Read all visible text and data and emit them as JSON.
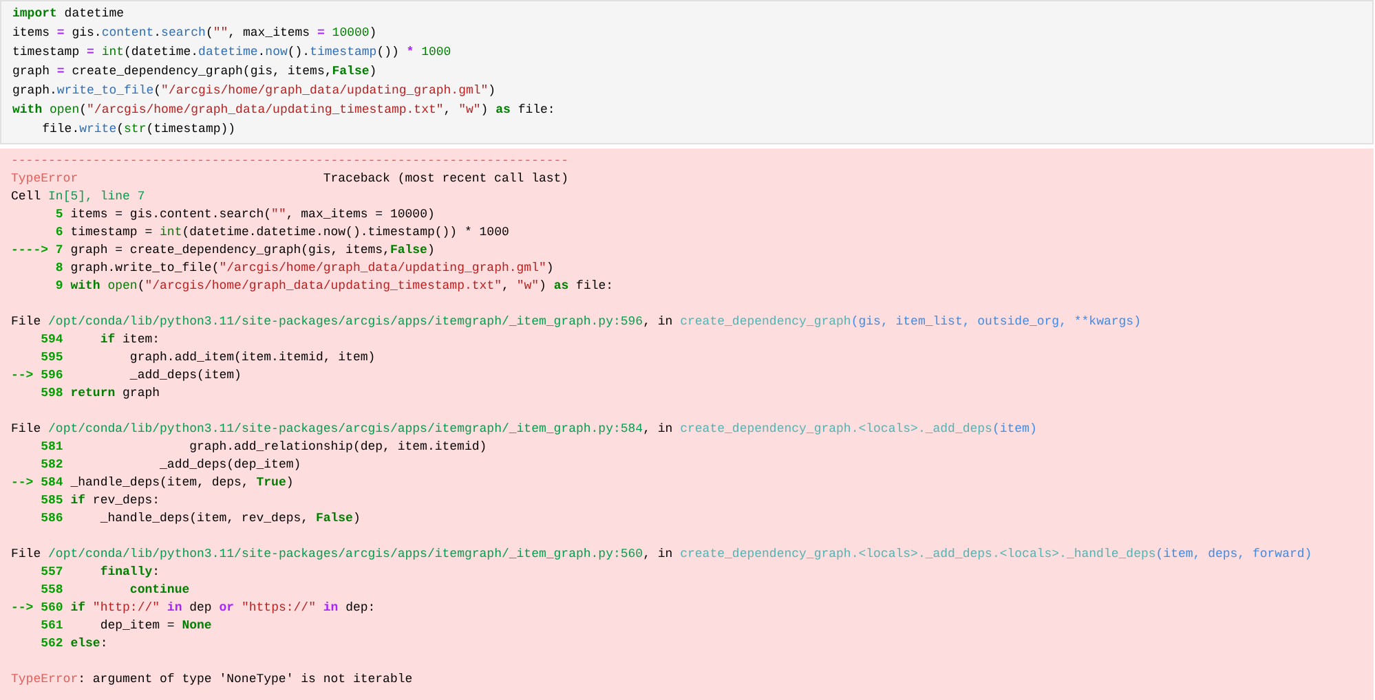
{
  "input_cell": {
    "lines": [
      {
        "kind": "code",
        "tokens": [
          {
            "text": "import",
            "kind": "kw"
          },
          {
            "text": " datetime",
            "kind": "plain"
          }
        ]
      },
      {
        "kind": "code",
        "tokens": [
          {
            "text": "items ",
            "kind": "plain"
          },
          {
            "text": "=",
            "kind": "op"
          },
          {
            "text": " gis.",
            "kind": "plain"
          },
          {
            "text": "content",
            "kind": "attr"
          },
          {
            "text": ".",
            "kind": "plain"
          },
          {
            "text": "search",
            "kind": "attr"
          },
          {
            "text": "(",
            "kind": "plain"
          },
          {
            "text": "\"\"",
            "kind": "str"
          },
          {
            "text": ", max_items ",
            "kind": "plain"
          },
          {
            "text": "=",
            "kind": "op"
          },
          {
            "text": " 10000",
            "kind": "num"
          },
          {
            "text": ")",
            "kind": "plain"
          }
        ]
      },
      {
        "kind": "code",
        "tokens": [
          {
            "text": "timestamp ",
            "kind": "plain"
          },
          {
            "text": "=",
            "kind": "op"
          },
          {
            "text": " int",
            "kind": "bi"
          },
          {
            "text": "(datetime.",
            "kind": "plain"
          },
          {
            "text": "datetime",
            "kind": "attr"
          },
          {
            "text": ".",
            "kind": "plain"
          },
          {
            "text": "now",
            "kind": "attr"
          },
          {
            "text": "().",
            "kind": "plain"
          },
          {
            "text": "timestamp",
            "kind": "attr"
          },
          {
            "text": "()) ",
            "kind": "plain"
          },
          {
            "text": "*",
            "kind": "op"
          },
          {
            "text": " 1000",
            "kind": "num"
          }
        ]
      },
      {
        "kind": "code",
        "tokens": [
          {
            "text": "graph ",
            "kind": "plain"
          },
          {
            "text": "=",
            "kind": "op"
          },
          {
            "text": " create_dependency_graph(gis, items,",
            "kind": "plain"
          },
          {
            "text": "False",
            "kind": "kw"
          },
          {
            "text": ")",
            "kind": "plain"
          }
        ]
      },
      {
        "kind": "code",
        "tokens": [
          {
            "text": "graph.",
            "kind": "plain"
          },
          {
            "text": "write_to_file",
            "kind": "attr"
          },
          {
            "text": "(",
            "kind": "plain"
          },
          {
            "text": "\"/arcgis/home/graph_data/updating_graph.gml\"",
            "kind": "str"
          },
          {
            "text": ")",
            "kind": "plain"
          }
        ]
      },
      {
        "kind": "code",
        "tokens": [
          {
            "text": "with",
            "kind": "kw"
          },
          {
            "text": " open",
            "kind": "bi"
          },
          {
            "text": "(",
            "kind": "plain"
          },
          {
            "text": "\"/arcgis/home/graph_data/updating_timestamp.txt\"",
            "kind": "str"
          },
          {
            "text": ", ",
            "kind": "plain"
          },
          {
            "text": "\"w\"",
            "kind": "str"
          },
          {
            "text": ") ",
            "kind": "plain"
          },
          {
            "text": "as",
            "kind": "kw"
          },
          {
            "text": " file:",
            "kind": "plain"
          }
        ]
      },
      {
        "kind": "code",
        "tokens": [
          {
            "text": "    file.",
            "kind": "plain"
          },
          {
            "text": "write",
            "kind": "attr"
          },
          {
            "text": "(",
            "kind": "plain"
          },
          {
            "text": "str",
            "kind": "bi"
          },
          {
            "text": "(timestamp))",
            "kind": "plain"
          }
        ]
      }
    ]
  },
  "error_output": {
    "lines": [
      {
        "kind": "code",
        "tokens": [
          {
            "text": "---------------------------------------------------------------------------",
            "kind": "err"
          }
        ]
      },
      {
        "kind": "code",
        "tokens": [
          {
            "text": "TypeError",
            "kind": "err"
          },
          {
            "text": "                                 Traceback (most recent call last)",
            "kind": "plain"
          }
        ]
      },
      {
        "kind": "code",
        "tokens": [
          {
            "text": "Cell ",
            "kind": "plain"
          },
          {
            "text": "In[5], line 7",
            "kind": "path"
          }
        ]
      },
      {
        "kind": "code",
        "tokens": [
          {
            "text": "      5",
            "kind": "lineno"
          },
          {
            "text": " items = gis.content.search(",
            "kind": "plain"
          },
          {
            "text": "\"\"",
            "kind": "str"
          },
          {
            "text": ", max_items = 10000)",
            "kind": "plain"
          }
        ]
      },
      {
        "kind": "code",
        "tokens": [
          {
            "text": "      6",
            "kind": "lineno"
          },
          {
            "text": " timestamp = ",
            "kind": "plain"
          },
          {
            "text": "int",
            "kind": "bi"
          },
          {
            "text": "(datetime.datetime.now().timestamp()) * 1000",
            "kind": "plain"
          }
        ]
      },
      {
        "kind": "code",
        "tokens": [
          {
            "text": "----> 7",
            "kind": "lineno"
          },
          {
            "text": " graph = create_dependency_graph(gis, items,",
            "kind": "plain"
          },
          {
            "text": "False",
            "kind": "kw"
          },
          {
            "text": ")",
            "kind": "plain"
          }
        ]
      },
      {
        "kind": "code",
        "tokens": [
          {
            "text": "      8",
            "kind": "lineno"
          },
          {
            "text": " graph.write_to_file(",
            "kind": "plain"
          },
          {
            "text": "\"/arcgis/home/graph_data/updating_graph.gml\"",
            "kind": "str"
          },
          {
            "text": ")",
            "kind": "plain"
          }
        ]
      },
      {
        "kind": "code",
        "tokens": [
          {
            "text": "      9",
            "kind": "lineno"
          },
          {
            "text": " with",
            "kind": "kw"
          },
          {
            "text": " open",
            "kind": "bi"
          },
          {
            "text": "(",
            "kind": "plain"
          },
          {
            "text": "\"/arcgis/home/graph_data/updating_timestamp.txt\"",
            "kind": "str"
          },
          {
            "text": ", ",
            "kind": "plain"
          },
          {
            "text": "\"w\"",
            "kind": "str"
          },
          {
            "text": ") ",
            "kind": "plain"
          },
          {
            "text": "as",
            "kind": "kw"
          },
          {
            "text": " file:",
            "kind": "plain"
          }
        ]
      },
      {
        "kind": "blank"
      },
      {
        "kind": "code",
        "tokens": [
          {
            "text": "File ",
            "kind": "plain"
          },
          {
            "text": "/opt/conda/lib/python3.11/site-packages/arcgis/apps/itemgraph/_item_graph.py:596",
            "kind": "path"
          },
          {
            "text": ", in ",
            "kind": "plain"
          },
          {
            "text": "create_dependency_graph",
            "kind": "fn"
          },
          {
            "text": "(gis, item_list, outside_org, **kwargs)",
            "kind": "args"
          }
        ]
      },
      {
        "kind": "code",
        "tokens": [
          {
            "text": "    594",
            "kind": "lineno"
          },
          {
            "text": "     if",
            "kind": "kw"
          },
          {
            "text": " item:",
            "kind": "plain"
          }
        ]
      },
      {
        "kind": "code",
        "tokens": [
          {
            "text": "    595",
            "kind": "lineno"
          },
          {
            "text": "         graph.add_item(item.itemid, item)",
            "kind": "plain"
          }
        ]
      },
      {
        "kind": "code",
        "tokens": [
          {
            "text": "--> 596",
            "kind": "lineno"
          },
          {
            "text": "         _add_deps(item)",
            "kind": "plain"
          }
        ]
      },
      {
        "kind": "code",
        "tokens": [
          {
            "text": "    598",
            "kind": "lineno"
          },
          {
            "text": " return",
            "kind": "kw"
          },
          {
            "text": " graph",
            "kind": "plain"
          }
        ]
      },
      {
        "kind": "blank"
      },
      {
        "kind": "code",
        "tokens": [
          {
            "text": "File ",
            "kind": "plain"
          },
          {
            "text": "/opt/conda/lib/python3.11/site-packages/arcgis/apps/itemgraph/_item_graph.py:584",
            "kind": "path"
          },
          {
            "text": ", in ",
            "kind": "plain"
          },
          {
            "text": "create_dependency_graph.<locals>._add_deps",
            "kind": "fn"
          },
          {
            "text": "(item)",
            "kind": "args"
          }
        ]
      },
      {
        "kind": "code",
        "tokens": [
          {
            "text": "    581",
            "kind": "lineno"
          },
          {
            "text": "                 graph.add_relationship(dep, item.itemid)",
            "kind": "plain"
          }
        ]
      },
      {
        "kind": "code",
        "tokens": [
          {
            "text": "    582",
            "kind": "lineno"
          },
          {
            "text": "             _add_deps(dep_item)",
            "kind": "plain"
          }
        ]
      },
      {
        "kind": "code",
        "tokens": [
          {
            "text": "--> 584",
            "kind": "lineno"
          },
          {
            "text": " _handle_deps(item, deps, ",
            "kind": "plain"
          },
          {
            "text": "True",
            "kind": "kw"
          },
          {
            "text": ")",
            "kind": "plain"
          }
        ]
      },
      {
        "kind": "code",
        "tokens": [
          {
            "text": "    585",
            "kind": "lineno"
          },
          {
            "text": " if",
            "kind": "kw"
          },
          {
            "text": " rev_deps:",
            "kind": "plain"
          }
        ]
      },
      {
        "kind": "code",
        "tokens": [
          {
            "text": "    586",
            "kind": "lineno"
          },
          {
            "text": "     _handle_deps(item, rev_deps, ",
            "kind": "plain"
          },
          {
            "text": "False",
            "kind": "kw"
          },
          {
            "text": ")",
            "kind": "plain"
          }
        ]
      },
      {
        "kind": "blank"
      },
      {
        "kind": "code",
        "tokens": [
          {
            "text": "File ",
            "kind": "plain"
          },
          {
            "text": "/opt/conda/lib/python3.11/site-packages/arcgis/apps/itemgraph/_item_graph.py:560",
            "kind": "path"
          },
          {
            "text": ", in ",
            "kind": "plain"
          },
          {
            "text": "create_dependency_graph.<locals>._add_deps.<locals>._handle_deps",
            "kind": "fn"
          },
          {
            "text": "(item, deps, forward)",
            "kind": "args"
          }
        ]
      },
      {
        "kind": "code",
        "tokens": [
          {
            "text": "    557",
            "kind": "lineno"
          },
          {
            "text": "     finally",
            "kind": "kw"
          },
          {
            "text": ":",
            "kind": "plain"
          }
        ]
      },
      {
        "kind": "code",
        "tokens": [
          {
            "text": "    558",
            "kind": "lineno"
          },
          {
            "text": "         continue",
            "kind": "kw"
          }
        ]
      },
      {
        "kind": "code",
        "tokens": [
          {
            "text": "--> 560",
            "kind": "lineno"
          },
          {
            "text": " if",
            "kind": "kw"
          },
          {
            "text": " \"http://\"",
            "kind": "str"
          },
          {
            "text": " in",
            "kind": "op"
          },
          {
            "text": " dep ",
            "kind": "plain"
          },
          {
            "text": "or",
            "kind": "op"
          },
          {
            "text": " \"https://\"",
            "kind": "str"
          },
          {
            "text": " in",
            "kind": "op"
          },
          {
            "text": " dep:",
            "kind": "plain"
          }
        ]
      },
      {
        "kind": "code",
        "tokens": [
          {
            "text": "    561",
            "kind": "lineno"
          },
          {
            "text": "     dep_item = ",
            "kind": "plain"
          },
          {
            "text": "None",
            "kind": "kw"
          }
        ]
      },
      {
        "kind": "code",
        "tokens": [
          {
            "text": "    562",
            "kind": "lineno"
          },
          {
            "text": " else",
            "kind": "kw"
          },
          {
            "text": ":",
            "kind": "plain"
          }
        ]
      },
      {
        "kind": "blank"
      },
      {
        "kind": "code",
        "tokens": [
          {
            "text": "TypeError",
            "kind": "err"
          },
          {
            "text": ": argument of type 'NoneType' is not iterable",
            "kind": "plain"
          }
        ]
      }
    ]
  }
}
